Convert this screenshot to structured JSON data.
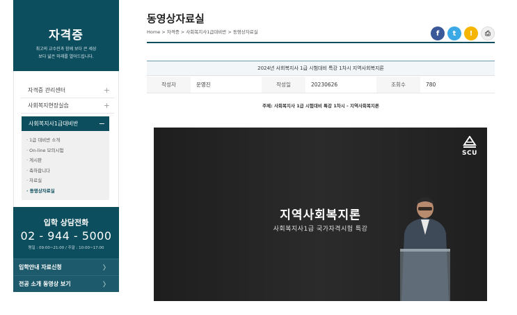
{
  "sidebar": {
    "title": "자격증",
    "subtitle_line1": "최고의 교수진과 함께 보다 큰 세상",
    "subtitle_line2": "보다 넓은 미래를 열어드립니다.",
    "menu": [
      {
        "label": "자격증 관리센터",
        "toggle": "+"
      },
      {
        "label": "사회복지현장실습",
        "toggle": "+"
      },
      {
        "label": "사회복지사1급대비반",
        "toggle": "−"
      }
    ],
    "submenu": [
      "· 1급 대비반 소개",
      "· On-line 모의시험",
      "· 게시판",
      "· 축하합니다",
      "· 자료실",
      "· 동영상자료실"
    ],
    "phone": {
      "label": "입학 상담전화",
      "number": "02 - 944 - 5000",
      "hours": "평일 : 09:00~21:00 / 주말 : 10:00~17:00"
    },
    "links": [
      {
        "label": "입학안내 자료신청",
        "arrow": "〉"
      },
      {
        "label": "전공 소개 동영상 보기",
        "arrow": "〉"
      }
    ]
  },
  "main": {
    "page_title": "동영상자료실",
    "breadcrumb": "Home > 자격증 > 사회복지사1급대비반 > 동영상자료실",
    "share": [
      {
        "icon": "facebook-icon",
        "glyph": "f",
        "color": "#3b5998"
      },
      {
        "icon": "twitter-icon",
        "glyph": "t",
        "color": "#3aa9e6"
      },
      {
        "icon": "kakaostory-icon",
        "glyph": "!",
        "color": "#f6b500"
      },
      {
        "icon": "print-icon",
        "glyph": "⎙",
        "color": "#f0f0f0"
      }
    ],
    "post": {
      "title": "2024년 사회복지사 1급 시험대비 특강 1차시 지역사회복지론",
      "author_label": "작성자",
      "author": "운영진",
      "date_label": "작성일",
      "date": "20230626",
      "views_label": "조회수",
      "views": "780",
      "subject": "주제: 사회복지사 1급 시험대비 특강 1차시 - 지역사회복지론"
    },
    "video": {
      "title": "지역사회복지론",
      "subtitle": "사회복지사1급 국가자격시험 특강",
      "logo_text": "SCU"
    }
  }
}
